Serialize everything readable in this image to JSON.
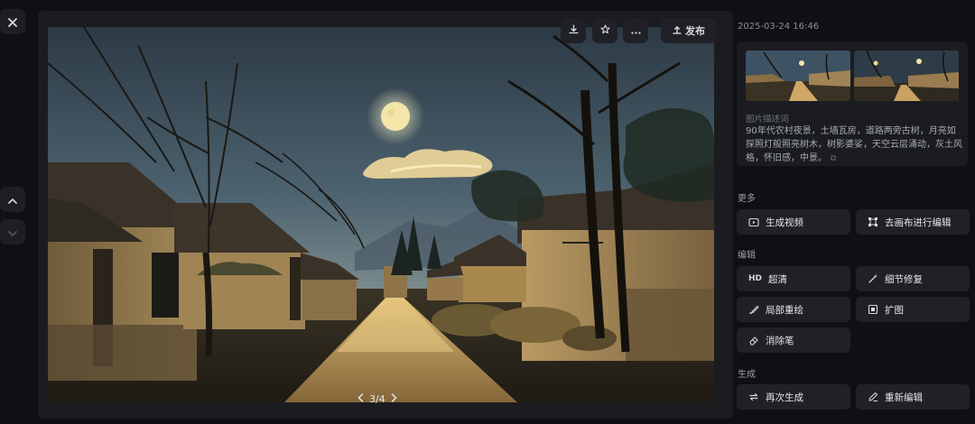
{
  "controls": {
    "close_label": "✕",
    "up_label": "⌃",
    "down_label": "⌄"
  },
  "toolbar": {
    "publish_label": "发布"
  },
  "pager": {
    "text": "3/4"
  },
  "panel": {
    "timestamp": "2025-03-24 16:46",
    "description_label": "图片描述词",
    "description": "90年代农村夜景，土墙瓦房，道路两旁古树，月亮如探照灯般照亮树木，树影婆娑，天空云层涌动，灰土风格，怀旧感，中景。",
    "sections": {
      "more": "更多",
      "edit": "编辑",
      "generate": "生成"
    },
    "actions": {
      "generate_video": "生成视频",
      "canvas_edit": "去画布进行编辑",
      "hd_badge": "HD",
      "super_res": "超清",
      "detail_fix": "细节修复",
      "local_redraw": "局部重绘",
      "expand": "扩图",
      "eraser": "消除笔",
      "regenerate": "再次生成",
      "re_edit": "重新编辑"
    }
  },
  "colors": {
    "background": "#0f1013",
    "panel_button": "#1f2126",
    "moon": "#f3e6a8",
    "road_glow": "#d9b061"
  }
}
